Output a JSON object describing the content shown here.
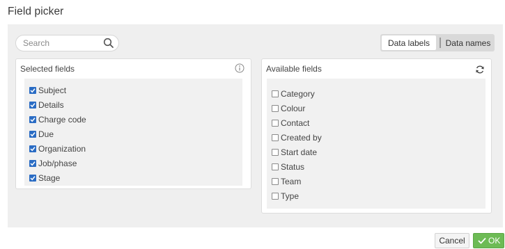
{
  "dialog": {
    "title": "Field picker"
  },
  "search": {
    "placeholder": "Search",
    "value": ""
  },
  "mode_toggle": {
    "data_labels": "Data labels",
    "data_names": "Data names",
    "active": "data_labels"
  },
  "selected_fields": {
    "header": "Selected fields",
    "items": [
      {
        "label": "Subject",
        "checked": true
      },
      {
        "label": "Details",
        "checked": true
      },
      {
        "label": "Charge code",
        "checked": true
      },
      {
        "label": "Due",
        "checked": true
      },
      {
        "label": "Organization",
        "checked": true
      },
      {
        "label": "Job/phase",
        "checked": true
      },
      {
        "label": "Stage",
        "checked": true
      }
    ]
  },
  "available_fields": {
    "header": "Available fields",
    "items": [
      {
        "label": "Category",
        "checked": false
      },
      {
        "label": "Colour",
        "checked": false
      },
      {
        "label": "Contact",
        "checked": false
      },
      {
        "label": "Created by",
        "checked": false
      },
      {
        "label": "Start date",
        "checked": false
      },
      {
        "label": "Status",
        "checked": false
      },
      {
        "label": "Team",
        "checked": false
      },
      {
        "label": "Type",
        "checked": false
      }
    ]
  },
  "footer": {
    "cancel_label": "Cancel",
    "ok_label": "OK"
  },
  "colors": {
    "checkbox": "#2a6cc4",
    "ok_button": "#6dbb55",
    "body_background": "#efefef"
  },
  "icons": {
    "search": "search-icon",
    "info": "info-icon",
    "refresh": "refresh-icon",
    "check": "check-icon"
  }
}
